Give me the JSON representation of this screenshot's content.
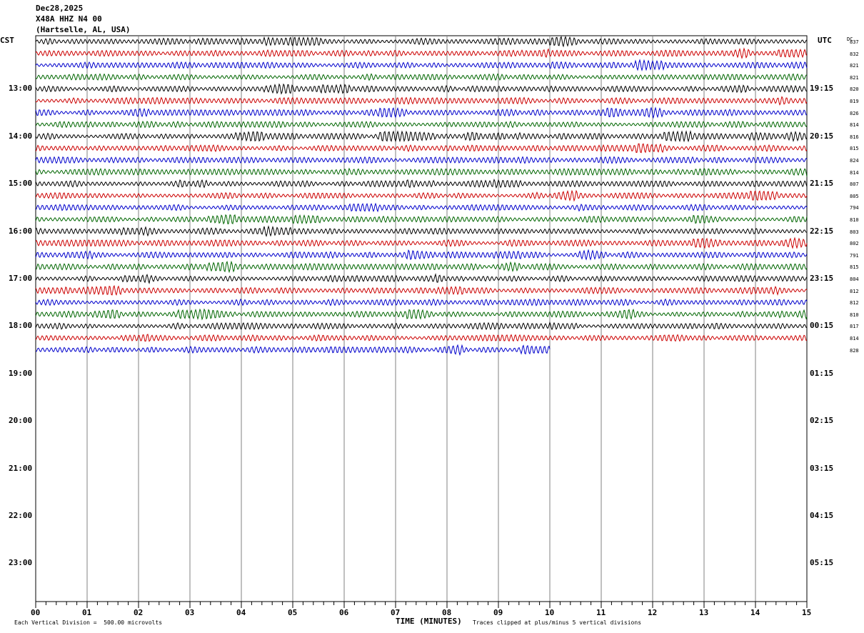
{
  "header": {
    "date": "Dec28,2025",
    "station": "X48A HHZ N4 00",
    "location": "(Hartselle, AL, USA)"
  },
  "left_tz": "CST",
  "right_tz": "UTC",
  "dc_label": "DC",
  "footer": {
    "scale_note": "Each Vertical Division =  500.00 microvolts",
    "xlabel": "TIME (MINUTES)",
    "clip_note": "Traces clipped at plus/minus 5 vertical divisions"
  },
  "chart_data": {
    "type": "line",
    "title": "X48A HHZ N4 00",
    "xlabel": "TIME (MINUTES)",
    "xlim": [
      0,
      15
    ],
    "x_ticks": [
      "00",
      "01",
      "02",
      "03",
      "04",
      "05",
      "06",
      "07",
      "08",
      "09",
      "10",
      "11",
      "12",
      "13",
      "14",
      "15"
    ],
    "left_hour_labels": [
      "13:00",
      "14:00",
      "15:00",
      "16:00",
      "17:00",
      "18:00",
      "19:00",
      "20:00",
      "21:00",
      "22:00",
      "23:00"
    ],
    "right_hour_labels": [
      "19:15",
      "20:15",
      "21:15",
      "22:15",
      "23:15",
      "00:15",
      "01:15",
      "02:15",
      "03:15",
      "04:15",
      "05:15"
    ],
    "trace_colors": [
      "#000000",
      "#cc0000",
      "#0000cc",
      "#006600"
    ],
    "dc_offsets": [
      837,
      832,
      821,
      821,
      820,
      819,
      826,
      814,
      816,
      815,
      824,
      814,
      807,
      805,
      794,
      810,
      803,
      802,
      791,
      815,
      804,
      812,
      812,
      810,
      817,
      814,
      828
    ],
    "trace_count": 27,
    "last_trace_end_minute": 10,
    "grid": true
  }
}
